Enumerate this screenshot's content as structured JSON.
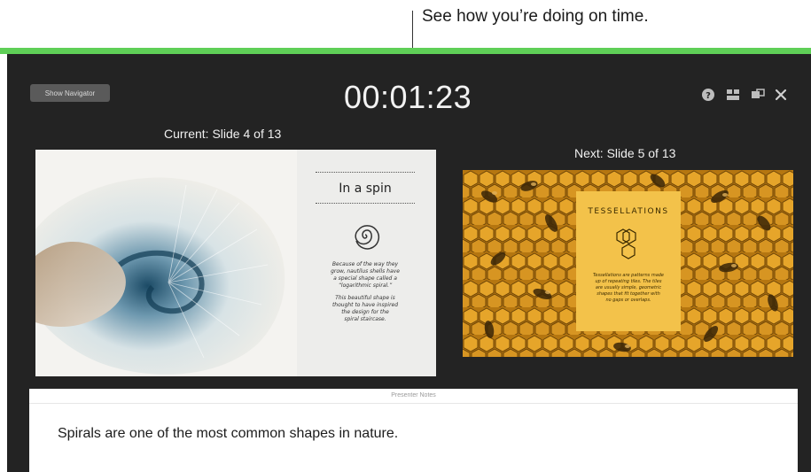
{
  "callout": {
    "text": "See how you’re doing on time."
  },
  "toolbar": {
    "show_navigator_label": "Show Navigator",
    "timer": "00:01:23",
    "icons": [
      "help-icon",
      "slide-layout-icon",
      "switch-displays-icon",
      "close-icon"
    ]
  },
  "current": {
    "label": "Current: Slide 4 of 13",
    "slide": {
      "title": "In a spin",
      "body": [
        "Because of the way they",
        "grow, nautilus shells have",
        "a special shape called a",
        "“logarithmic spiral.”",
        "",
        "This beautiful shape is",
        "thought to have inspired",
        "the design for the",
        "spiral staircase."
      ]
    }
  },
  "next": {
    "label": "Next: Slide 5 of 13",
    "slide": {
      "title": "TESSELLATIONS",
      "body": [
        "Tessellations are patterns made",
        "up of repeating tiles. The tiles",
        "are usually simple, geometric",
        "shapes that fit together with",
        "no gaps or overlaps."
      ]
    }
  },
  "notes": {
    "header": "Presenter Notes",
    "text": "Spirals are one of the most common shapes in nature."
  },
  "colors": {
    "accent_green": "#5fcf57",
    "screen_bg": "#232323",
    "honeycomb": "#c98a16",
    "card_yellow": "#f3c24a"
  }
}
